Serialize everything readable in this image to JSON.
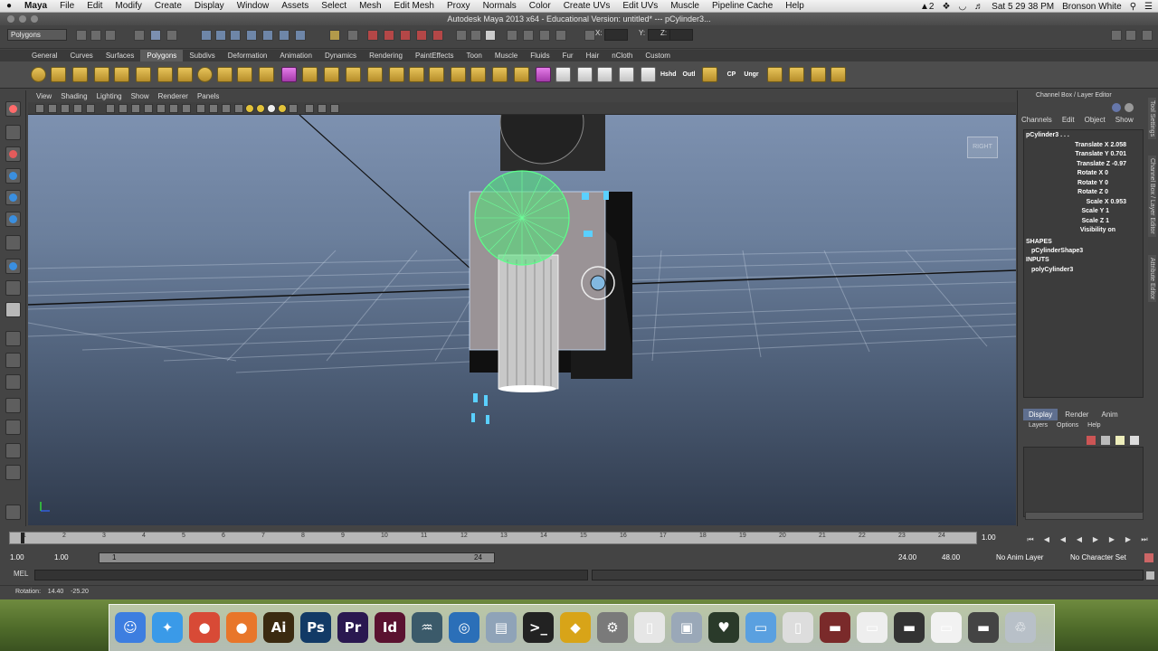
{
  "menubar": {
    "app_name": "Maya",
    "items": [
      "File",
      "Edit",
      "Modify",
      "Create",
      "Display",
      "Window",
      "Assets",
      "Select",
      "Mesh",
      "Edit Mesh",
      "Proxy",
      "Normals",
      "Color",
      "Create UVs",
      "Edit UVs",
      "Muscle",
      "Pipeline Cache",
      "Help"
    ],
    "status_count": "2",
    "clock": "Sat 5 29 38 PM",
    "user": "Bronson White"
  },
  "window": {
    "title": "Autodesk Maya 2013 x64 - Educational Version: untitled*   ---   pCylinder3..."
  },
  "statusline": {
    "mode": "Polygons",
    "x_label": "X:",
    "y_label": "Y:",
    "z_label": "Z:"
  },
  "shelf": {
    "tabs": [
      "General",
      "Curves",
      "Surfaces",
      "Polygons",
      "Subdivs",
      "Deformation",
      "Animation",
      "Dynamics",
      "Rendering",
      "PaintEffects",
      "Toon",
      "Muscle",
      "Fluids",
      "Fur",
      "Hair",
      "nCloth",
      "Custom"
    ],
    "active_tab": "Polygons",
    "labeled_icons": [
      "Hshd",
      "Outl",
      "CP",
      "Ungr"
    ]
  },
  "panel": {
    "menu": [
      "View",
      "Shading",
      "Lighting",
      "Show",
      "Renderer",
      "Panels"
    ],
    "viewcube_label": "RIGHT"
  },
  "channelbox": {
    "title": "Channel Box / Layer Editor",
    "menu": [
      "Channels",
      "Edit",
      "Object",
      "Show"
    ],
    "object": "pCylinder3 . . .",
    "attributes": [
      {
        "name": "Translate X",
        "value": "2.058"
      },
      {
        "name": "Translate Y",
        "value": "0.701"
      },
      {
        "name": "Translate Z",
        "value": "-0.97"
      },
      {
        "name": "Rotate X",
        "value": "0"
      },
      {
        "name": "Rotate Y",
        "value": "0"
      },
      {
        "name": "Rotate Z",
        "value": "0"
      },
      {
        "name": "Scale X",
        "value": "0.953"
      },
      {
        "name": "Scale Y",
        "value": "1"
      },
      {
        "name": "Scale Z",
        "value": "1"
      },
      {
        "name": "Visibility",
        "value": "on"
      }
    ],
    "shapes_label": "SHAPES",
    "shape_node": "pCylinderShape3",
    "inputs_label": "INPUTS",
    "input_node": "polyCylinder3",
    "side_tabs": [
      "Tool Settings",
      "Channel Box / Layer Editor",
      "Attribute Editor"
    ]
  },
  "layers": {
    "tabs": [
      "Display",
      "Render",
      "Anim"
    ],
    "active_tab": "Display",
    "menu": [
      "Layers",
      "Options",
      "Help"
    ]
  },
  "timeline": {
    "ticks": [
      "1",
      "2",
      "3",
      "4",
      "5",
      "6",
      "7",
      "8",
      "9",
      "10",
      "11",
      "12",
      "13",
      "14",
      "15",
      "16",
      "17",
      "18",
      "19",
      "20",
      "21",
      "22",
      "23",
      "24"
    ],
    "current_frame": "1.00",
    "start_time": "1.00",
    "playback_start": "1.00",
    "range_start": "1",
    "range_end": "24",
    "playback_end": "24.00",
    "end_time": "48.00",
    "anim_layer": "No Anim Layer",
    "character_set": "No Character Set"
  },
  "commandline": {
    "label": "MEL"
  },
  "helpline": {
    "text": "Rotation:    14.40    -25.20"
  },
  "dock": {
    "apps": [
      {
        "name": "Finder",
        "glyph": "☺",
        "color": "#3d7ee0"
      },
      {
        "name": "Safari",
        "glyph": "✦",
        "color": "#3a9ae8"
      },
      {
        "name": "Chrome",
        "glyph": "●",
        "color": "#d84a36"
      },
      {
        "name": "Firefox",
        "glyph": "●",
        "color": "#e8762a"
      },
      {
        "name": "Illustrator",
        "glyph": "Ai",
        "color": "#3b2a10"
      },
      {
        "name": "Photoshop",
        "glyph": "Ps",
        "color": "#123a66"
      },
      {
        "name": "Premiere",
        "glyph": "Pr",
        "color": "#2a1850"
      },
      {
        "name": "InDesign",
        "glyph": "Id",
        "color": "#5a1230"
      },
      {
        "name": "Maya",
        "glyph": "♒",
        "color": "#3b5a6a"
      },
      {
        "name": "Network",
        "glyph": "◎",
        "color": "#2b6fb8"
      },
      {
        "name": "Preview",
        "glyph": "▤",
        "color": "#8fa3b8"
      },
      {
        "name": "Terminal",
        "glyph": ">_",
        "color": "#222222"
      },
      {
        "name": "Unity",
        "glyph": "◆",
        "color": "#d8a418"
      },
      {
        "name": "Settings",
        "glyph": "⚙",
        "color": "#7a7a7a"
      },
      {
        "name": "TextEdit",
        "glyph": "▯",
        "color": "#e6e6e6"
      },
      {
        "name": "Photos",
        "glyph": "▣",
        "color": "#9aa8b8"
      },
      {
        "name": "Activity",
        "glyph": "♥",
        "color": "#2a3a2a"
      },
      {
        "name": "Folder",
        "glyph": "▭",
        "color": "#5aa0e0"
      },
      {
        "name": "Document",
        "glyph": "▯",
        "color": "#dddddd"
      },
      {
        "name": "Media",
        "glyph": "▬",
        "color": "#7a2a2a"
      },
      {
        "name": "Blank",
        "glyph": "▭",
        "color": "#eeeeee"
      },
      {
        "name": "Display",
        "glyph": "▬",
        "color": "#333333"
      },
      {
        "name": "Sheet",
        "glyph": "▭",
        "color": "#f2f2f2"
      },
      {
        "name": "Device",
        "glyph": "▬",
        "color": "#444444"
      },
      {
        "name": "Trash",
        "glyph": "♲",
        "color": "#b8c0c8"
      }
    ]
  }
}
